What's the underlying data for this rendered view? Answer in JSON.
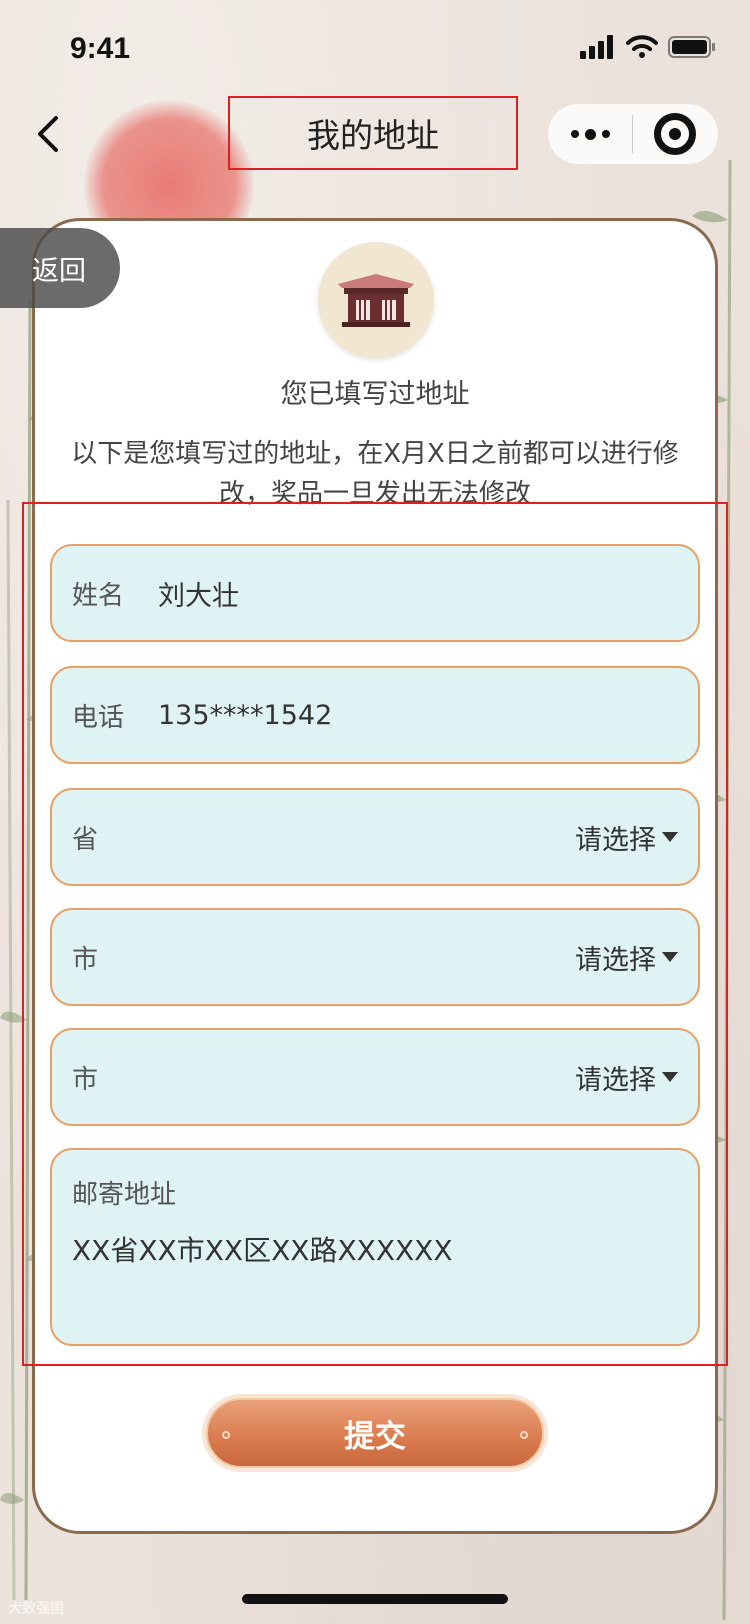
{
  "status_bar": {
    "time": "9:41"
  },
  "nav": {
    "title": "我的地址"
  },
  "back_label": "返回",
  "heading": "您已填写过地址",
  "notice": "以下是您填写过的地址，在X月X日之前都可以进行修改，奖品一旦发出无法修改",
  "form": {
    "name": {
      "label": "姓名",
      "value": "刘大壮"
    },
    "phone": {
      "label": "电话",
      "value": "135****1542"
    },
    "province": {
      "label": "省",
      "placeholder": "请选择"
    },
    "city": {
      "label": "市",
      "placeholder": "请选择"
    },
    "district": {
      "label": "市",
      "placeholder": "请选择"
    },
    "address": {
      "label": "邮寄地址",
      "value": "XX省XX市XX区XX路XXXXXX"
    }
  },
  "submit_label": "提交",
  "watermark": "大致强国",
  "colors": {
    "field_bg": "#e0f3f4",
    "field_border": "#e8a062",
    "submit": "#d97a4e",
    "highlight": "#e02020",
    "card_border": "#8a6a4e"
  },
  "icons": [
    "chevron-left-icon",
    "more-dots-icon",
    "target-icon",
    "temple-icon",
    "caret-down-icon",
    "signal-icon",
    "wifi-icon",
    "battery-icon"
  ]
}
